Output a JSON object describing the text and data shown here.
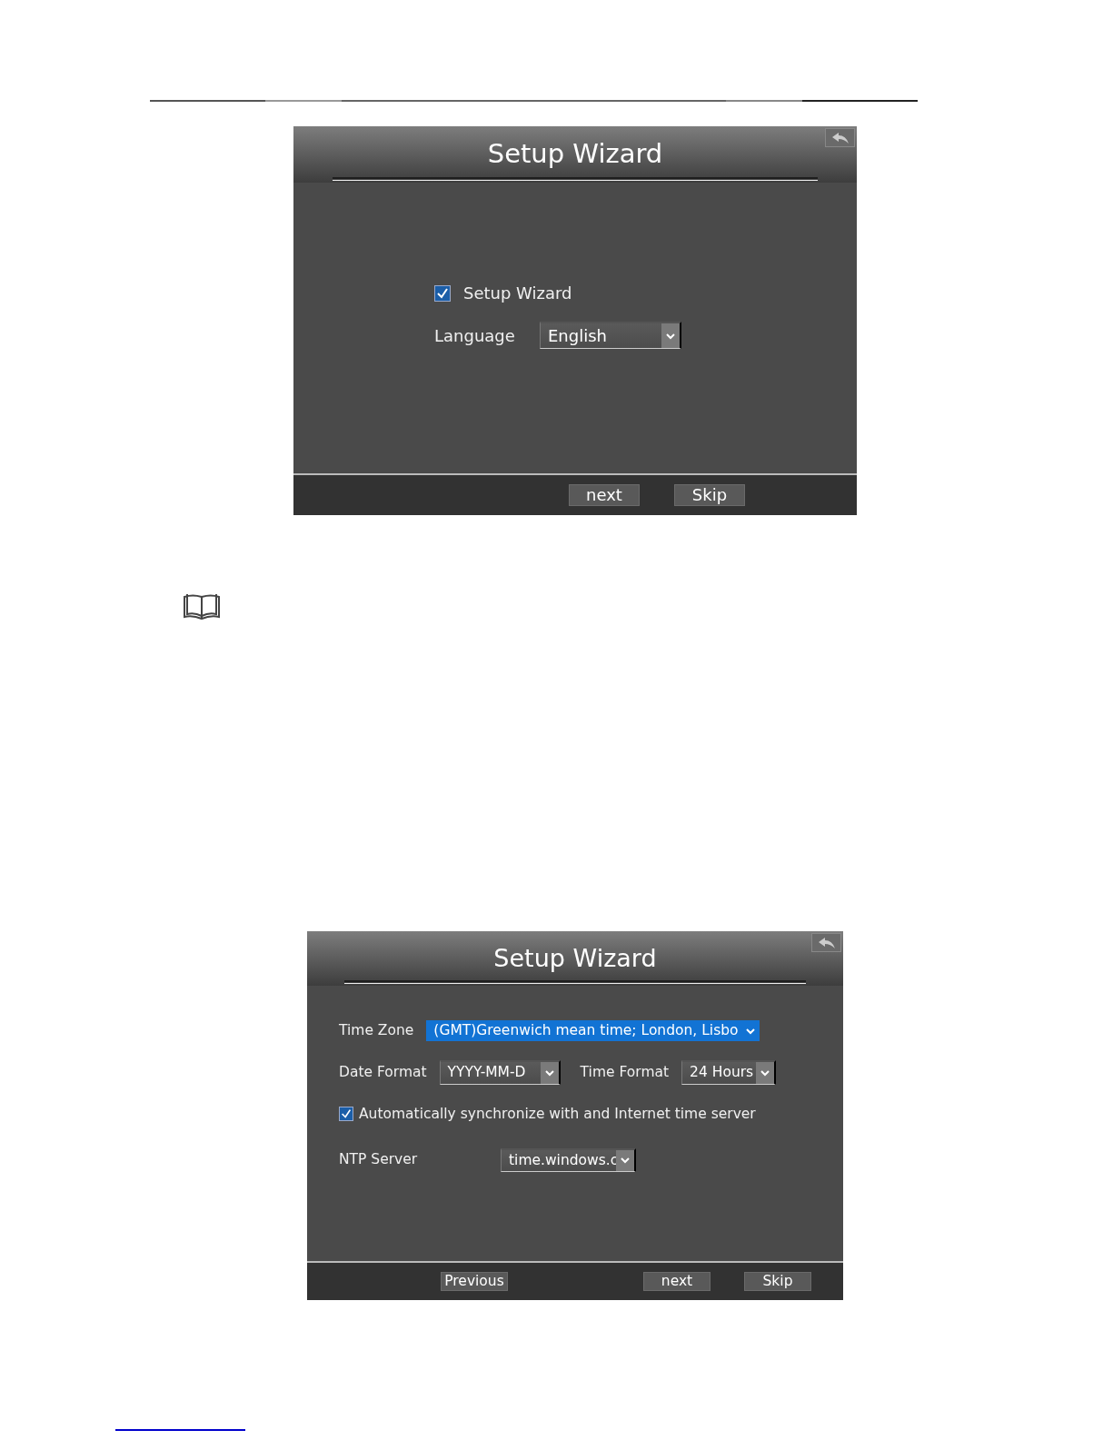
{
  "screens": [
    {
      "title": "Setup Wizard",
      "rows": [
        {
          "controls": [
            {
              "kind": "checkbox",
              "label": "Setup Wizard",
              "checked": true
            }
          ]
        },
        {
          "controls": [
            {
              "kind": "select",
              "label": "Language",
              "value": "English",
              "highlighted": false
            }
          ]
        }
      ],
      "buttons": [
        {
          "label": "next"
        },
        {
          "label": "Skip"
        }
      ]
    },
    {
      "title": "Setup Wizard",
      "rows": [
        {
          "controls": [
            {
              "kind": "select",
              "label": "Time Zone",
              "value": "(GMT)Greenwich mean time; London, Lisbo",
              "highlighted": true
            }
          ]
        },
        {
          "controls": [
            {
              "kind": "select",
              "label": "Date Format",
              "value": "YYYY-MM-D",
              "highlighted": false
            },
            {
              "kind": "select",
              "label": "Time Format",
              "value": "24 Hours",
              "highlighted": false
            }
          ]
        },
        {
          "controls": [
            {
              "kind": "checkbox",
              "label": "Automatically synchronize with and Internet time server",
              "checked": true
            }
          ]
        },
        {
          "controls": [
            {
              "kind": "select",
              "label": "NTP Server",
              "value": "time.windows.c",
              "highlighted": false
            }
          ]
        }
      ],
      "buttons": [
        {
          "label": "Previous"
        },
        {
          "label": "next"
        },
        {
          "label": "Skip"
        }
      ]
    }
  ]
}
